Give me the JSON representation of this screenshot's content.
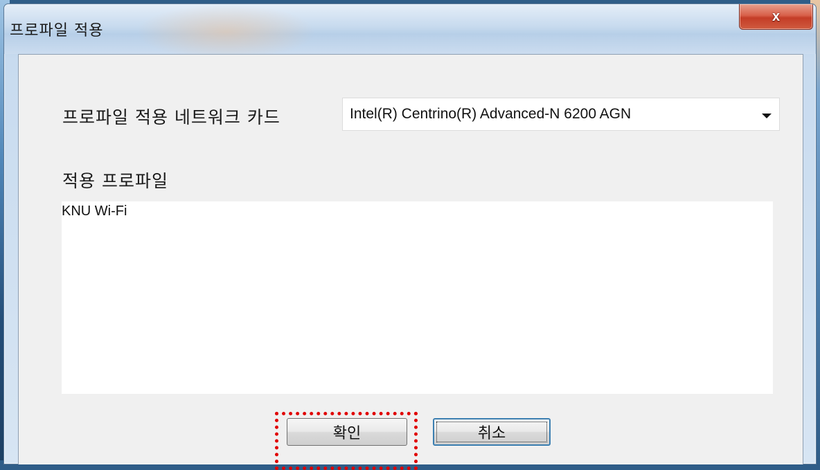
{
  "window": {
    "title": "프로파일 적용",
    "close_glyph": "x"
  },
  "form": {
    "nic_label": "프로파일 적용 네트워크 카드",
    "nic_selected": "Intel(R) Centrino(R) Advanced-N 6200 AGN",
    "profile_label": "적용 프로파일",
    "profiles": [
      "KNU Wi-Fi"
    ]
  },
  "buttons": {
    "ok_label": "확인",
    "cancel_label": "취소"
  },
  "annotation": {
    "highlight_color": "#e00000"
  },
  "icons": {
    "close": "close-icon",
    "dropdown": "chevron-down-icon"
  }
}
